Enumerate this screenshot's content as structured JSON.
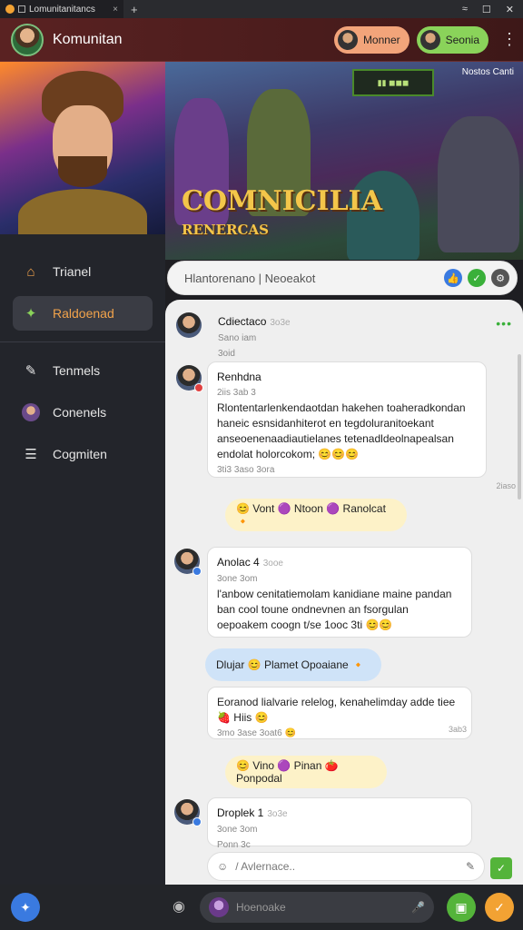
{
  "window": {
    "tab_title": "Lomunitanitancs",
    "new_tab": "+",
    "controls": [
      "≈",
      "☐",
      "✕"
    ]
  },
  "header": {
    "title": "Komunitan",
    "btn1": "Monner",
    "btn2": "Seonia",
    "menu": "⋮"
  },
  "sidebar": {
    "items": [
      {
        "label": "Trianel",
        "icon": "home-icon"
      },
      {
        "label": "Raldoenad",
        "icon": "puzzle-icon",
        "active": true
      },
      {
        "label": "Tenmels",
        "icon": "edit-icon"
      },
      {
        "label": "Conenels",
        "icon": "avatar-icon"
      },
      {
        "label": "Cogmiten",
        "icon": "list-icon"
      }
    ]
  },
  "banner": {
    "logo": "COMNICILIA",
    "sublogo": "RENERCAS",
    "tag": "Nostos Canti",
    "hud": "▮▮ ◼◼◼"
  },
  "search": {
    "placeholder": "Hlantorenano | Neoeakot"
  },
  "messages": [
    {
      "name": "Cdiectaco",
      "time": "3o3e",
      "meta1": "Sano iam",
      "meta2": "3oid",
      "dots": "•••"
    },
    {
      "name": "Renhdna",
      "time": "",
      "meta1": "2iis 3ab 3",
      "text": "Rlontentarlenkendaotdan hakehen toaheradkondan haneic esnsidanhiterot en tegdoluranitoekant anseoenenaadiautielanes tetenadldeolnapealsan endolat holorcokom;  😊😊😊",
      "foot": "3ti3 3aso 3ora",
      "reply": "2iaso"
    },
    {
      "name": "Anolac 4",
      "time": "3ooe",
      "meta1": "3one 3om",
      "text": "l'anbow cenitatiemolam kanidiane maine pandan ban cool toune ondnevnen an fsorgulan oepoakem coogn t/se 1ooc 3ti 😊😊"
    },
    {
      "text": "Eoranod lialvarie relelog, kenahelimday adde tiee 🍓 Hiis 😊",
      "foot": "3mo 3ase 3oat6 😊",
      "reply": "3ab3"
    },
    {
      "name": "Droplek 1",
      "time": "3o3e",
      "meta1": "3one 3om",
      "meta2": "Ponn 3c"
    }
  ],
  "reactions": [
    {
      "text": "😊 Vont 🟣 Ntoon 🟣 Ranolcat 🔸",
      "style": "yellow"
    },
    {
      "text": "Dlujar 😊 Plamet Opoaiane 🔸",
      "style": "blue"
    },
    {
      "text": "😊 Vino 🟣 Pinan 🍅 Ponpodal",
      "style": "yellow"
    }
  ],
  "input": {
    "placeholder": "/ Avlernace..",
    "smile": "☺"
  },
  "bottom": {
    "placeholder": "Hoenoake",
    "mic": "🎤"
  }
}
